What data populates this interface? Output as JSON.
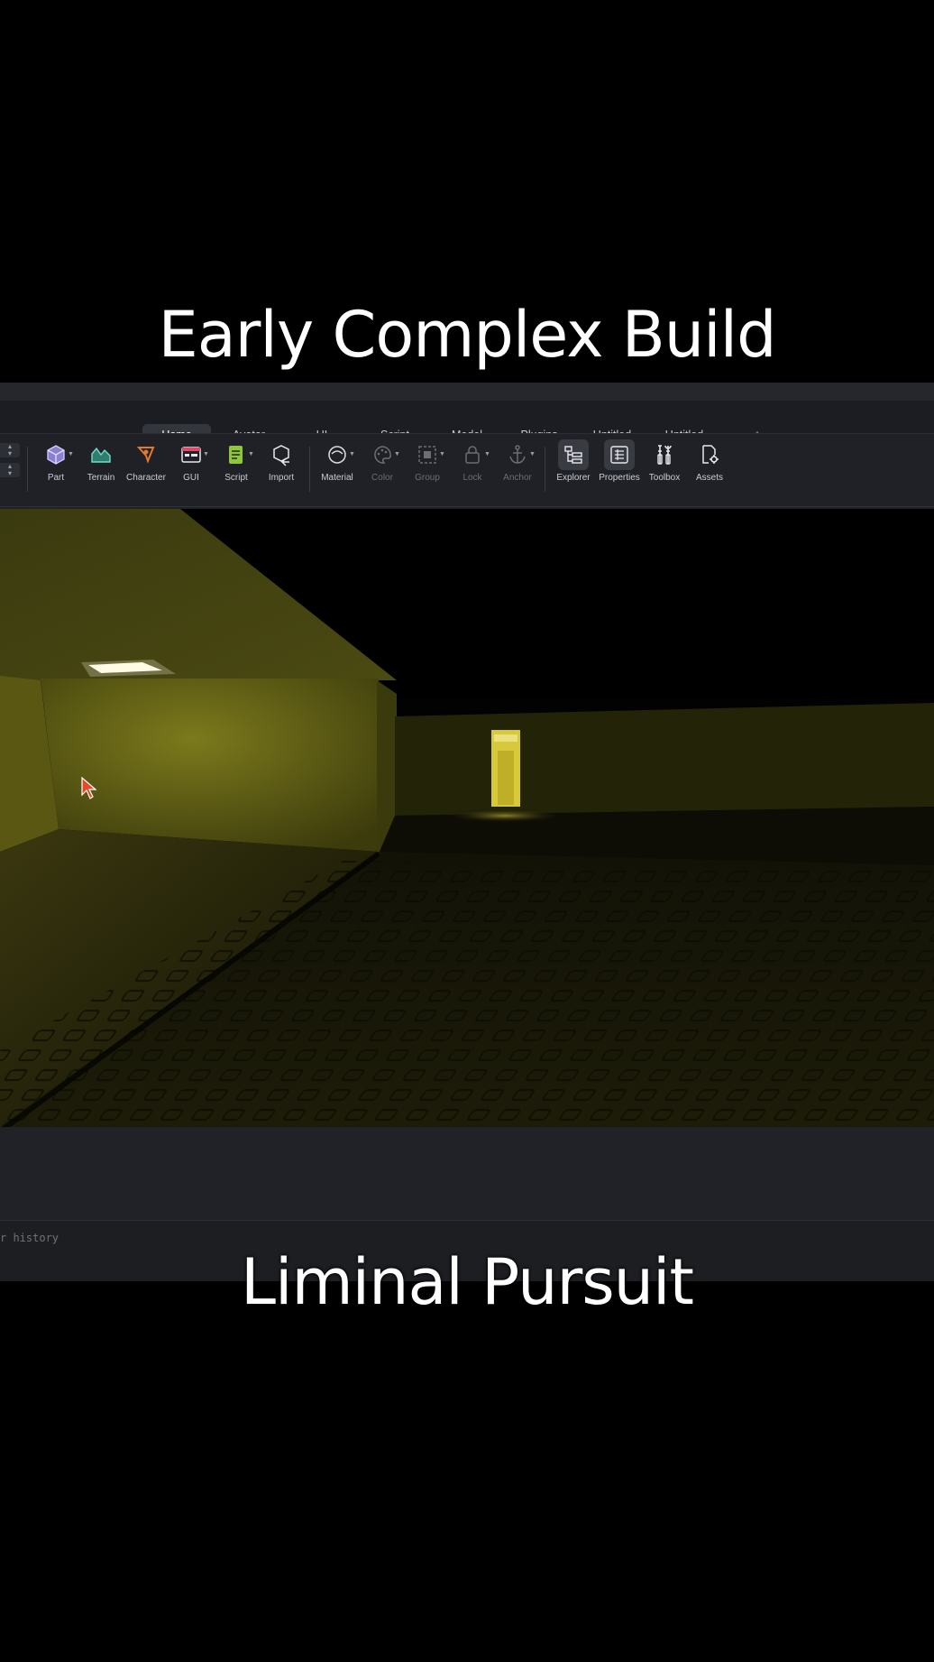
{
  "captions": {
    "top": "Early Complex Build",
    "bottom": "Liminal Pursuit"
  },
  "tabs": [
    {
      "label": "Home",
      "active": true
    },
    {
      "label": "Avatar"
    },
    {
      "label": "UI"
    },
    {
      "label": "Script"
    },
    {
      "label": "Model"
    },
    {
      "label": "Plugins"
    },
    {
      "label": "Untitled"
    },
    {
      "label": "Untitled"
    },
    {
      "label": "+"
    }
  ],
  "toolbar": {
    "part": {
      "label": "Part",
      "icon": "part-cube-icon"
    },
    "terrain": {
      "label": "Terrain",
      "icon": "terrain-icon"
    },
    "character": {
      "label": "Character",
      "icon": "character-icon"
    },
    "gui": {
      "label": "GUI",
      "icon": "gui-icon"
    },
    "script": {
      "label": "Script",
      "icon": "script-icon"
    },
    "import": {
      "label": "Import",
      "icon": "import-icon"
    },
    "material": {
      "label": "Material",
      "icon": "material-icon"
    },
    "color": {
      "label": "Color",
      "icon": "color-palette-icon"
    },
    "group": {
      "label": "Group",
      "icon": "group-icon"
    },
    "lock": {
      "label": "Lock",
      "icon": "lock-icon"
    },
    "anchor": {
      "label": "Anchor",
      "icon": "anchor-icon"
    },
    "explorer": {
      "label": "Explorer",
      "icon": "explorer-icon"
    },
    "properties": {
      "label": "Properties",
      "icon": "properties-icon"
    },
    "toolbox": {
      "label": "Toolbox",
      "icon": "toolbox-icon"
    },
    "assets": {
      "label": "Assets",
      "icon": "assets-icon"
    }
  },
  "command_bar": {
    "placeholder": "r history"
  },
  "colors": {
    "wall": "#6b6a17",
    "floor": "#2e2d0c",
    "doorway": "#d8c93a",
    "ceiling_light": "#fffbe6"
  }
}
